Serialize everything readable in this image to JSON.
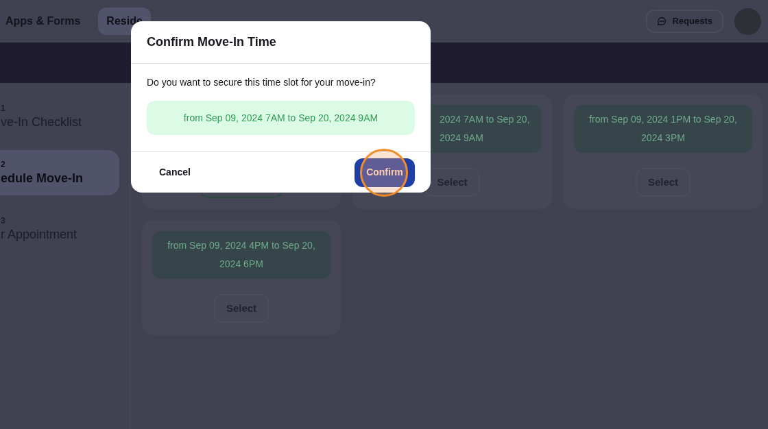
{
  "nav": {
    "items": [
      {
        "label": "Apps & Forms",
        "selected": false
      },
      {
        "label": "Reside",
        "selected": true
      }
    ],
    "requests_button": "Requests"
  },
  "steps": [
    {
      "number": "1",
      "title": "ve-In Checklist",
      "selected": false
    },
    {
      "number": "2",
      "title": "edule Move-In",
      "selected": true
    },
    {
      "number": "3",
      "title": "r Appointment",
      "selected": false
    }
  ],
  "slots": [
    {
      "kind": "hidden"
    },
    {
      "kind": "partial",
      "time": "2024 7AM to Sep 20, 2024 9AM",
      "button": "Select"
    },
    {
      "kind": "full",
      "time": "from Sep 09, 2024 1PM to Sep 20, 2024 3PM",
      "button": "Select"
    },
    {
      "kind": "full",
      "time": "from Sep 09, 2024 4PM to Sep 20, 2024 6PM",
      "button": "Select"
    }
  ],
  "dialog": {
    "title": "Confirm Move-In Time",
    "question": "Do you want to secure this time slot for your move-in?",
    "slot": "from Sep 09, 2024 7AM to Sep 20, 2024 9AM",
    "cancel": "Cancel",
    "confirm": "Confirm"
  }
}
